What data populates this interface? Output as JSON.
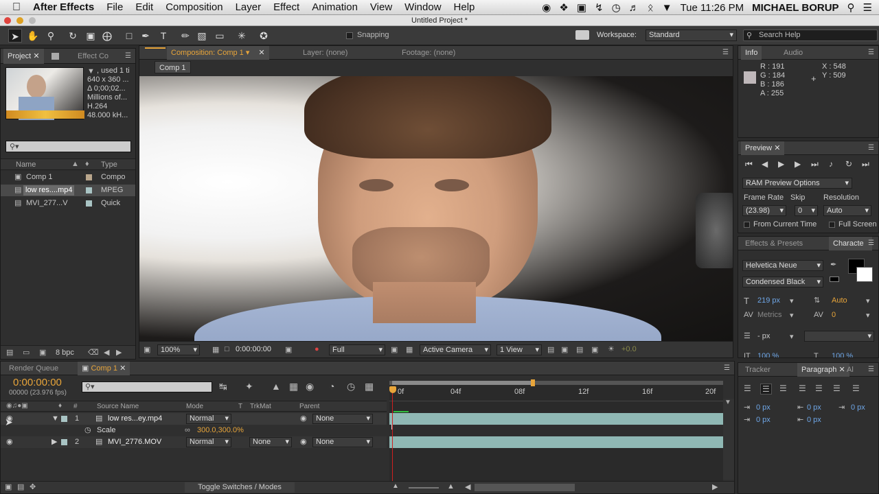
{
  "menubar": {
    "apple": "",
    "app_name": "After Effects",
    "items": [
      "File",
      "Edit",
      "Composition",
      "Layer",
      "Effect",
      "Animation",
      "View",
      "Window",
      "Help"
    ],
    "clock": "Tue 11:26 PM",
    "user": "MICHAEL BORUP"
  },
  "window_title": "Untitled Project *",
  "toolbar": {
    "snapping": "Snapping",
    "workspace_label": "Workspace:",
    "workspace_value": "Standard",
    "search_placeholder": "Search Help"
  },
  "project": {
    "tab_project": "Project",
    "tab_effect": "Effect Co",
    "info_lines": [
      ", used 1 ti",
      "640 x 360 ...",
      "Δ 0;00;02...",
      "Millions of...",
      "H.264",
      "48.000 kH..."
    ],
    "col_name": "Name",
    "col_type": "Type",
    "items": [
      {
        "name": "Comp 1",
        "type": "Compo",
        "icon": "comp-icon"
      },
      {
        "name": "low res....mp4",
        "type": "MPEG",
        "icon": "footage-icon"
      },
      {
        "name": "MVI_277...V",
        "type": "Quick",
        "icon": "footage-icon"
      }
    ],
    "bpc": "8 bpc"
  },
  "composition": {
    "tab_comp": "Composition: Comp 1",
    "tab_layer": "Layer: (none)",
    "tab_footage": "Footage: (none)",
    "breadcrumb": "Comp 1",
    "zoom": "100%",
    "timecode": "0:00:00:00",
    "resolution": "Full",
    "camera": "Active Camera",
    "views": "1 View",
    "exposure": "+0.0"
  },
  "info": {
    "tab_info": "Info",
    "tab_audio": "Audio",
    "r": "R : 191",
    "g": "G : 184",
    "b": "B : 186",
    "a": "A : 255",
    "x": "X : 548",
    "y": "Y : 509",
    "swatch_color": "#bfb8ba"
  },
  "preview": {
    "tab": "Preview",
    "ram_options": "RAM Preview Options",
    "frame_rate_label": "Frame Rate",
    "skip_label": "Skip",
    "resolution_label": "Resolution",
    "frame_rate_value": "(23.98)",
    "skip_value": "0",
    "resolution_value": "Auto",
    "from_current": "From Current Time",
    "full_screen": "Full Screen"
  },
  "character": {
    "tab_effects": "Effects & Presets",
    "tab_char": "Characte",
    "font": "Helvetica Neue",
    "style": "Condensed Black",
    "size": "219 px",
    "leading": "Auto",
    "kerning": "Metrics",
    "tracking": "0",
    "stroke": "- px",
    "scale_v": "100 %",
    "scale_h": "100 %"
  },
  "paragraph": {
    "tab_tracker": "Tracker",
    "tab_paragraph": "Paragraph",
    "tab_al": "Al",
    "indent_left": "0 px",
    "indent_right": "0 px",
    "indent_first": "0 px",
    "space_before": "0 px",
    "space_after": "0 px"
  },
  "timeline": {
    "tab_render": "Render Queue",
    "tab_comp": "Comp 1",
    "timecode": "0:00:00:00",
    "frames": "00000 (23.976 fps)",
    "search_placeholder": "",
    "col_source": "Source Name",
    "col_mode": "Mode",
    "col_t": "T",
    "col_trkmat": "TrkMat",
    "col_parent": "Parent",
    "col_hash": "#",
    "ruler": [
      "0f",
      "04f",
      "08f",
      "12f",
      "16f",
      "20f"
    ],
    "layers": [
      {
        "num": "1",
        "name": "low res...ey.mp4",
        "mode": "Normal",
        "trkmat": "",
        "parent": "None"
      },
      {
        "num": "2",
        "name": "MVI_2776.MOV",
        "mode": "Normal",
        "trkmat": "None",
        "parent": "None"
      }
    ],
    "scale_label": "Scale",
    "scale_value": "300.0,300.0%",
    "toggle_label": "Toggle Switches / Modes"
  },
  "colors": {
    "accent_orange": "#e8a53a",
    "value_blue": "#6fa7e8",
    "layer_bar": "#8fb8b4"
  }
}
